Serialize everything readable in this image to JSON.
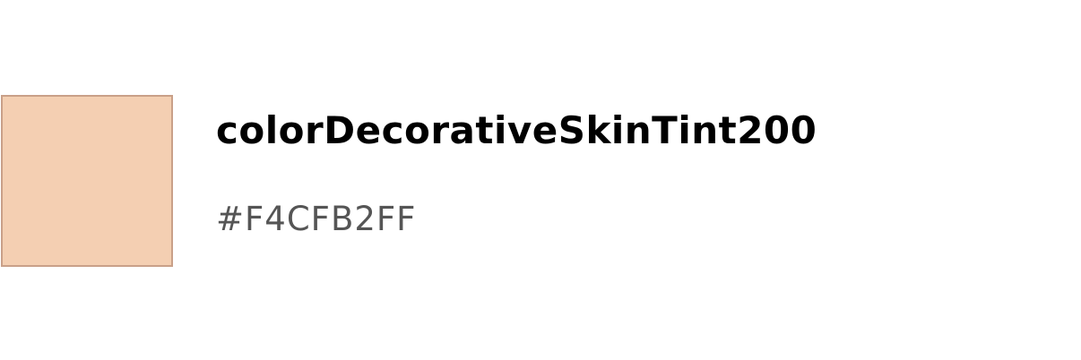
{
  "token": {
    "name": "colorDecorativeSkinTint200",
    "value": "#F4CFB2FF",
    "swatch_color": "#F4CFB2",
    "swatch_border_color": "#C9A088"
  }
}
